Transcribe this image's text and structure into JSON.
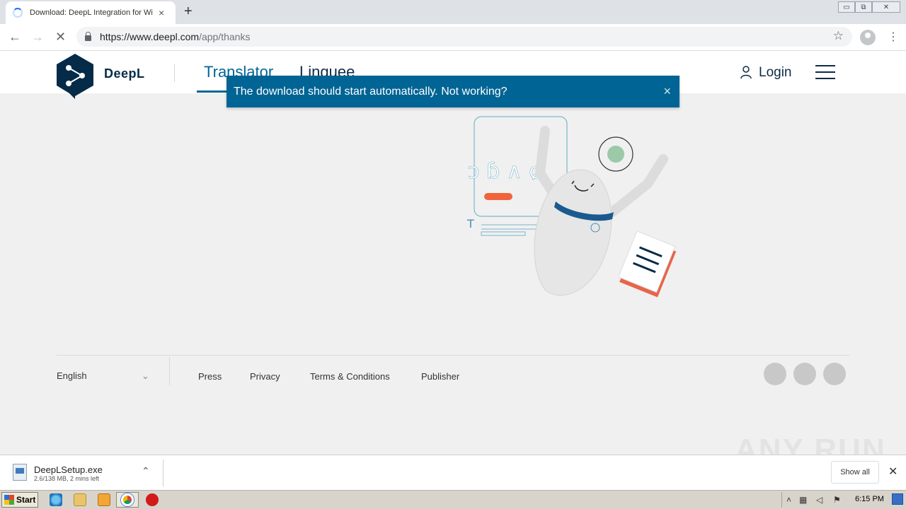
{
  "browser": {
    "tab_title": "Download: DeepL Integration for Wi",
    "tab_close": "×",
    "new_tab": "+",
    "url_host": "https://www.deepl.com",
    "url_path": "/app/thanks",
    "window_controls": [
      "▭",
      "⧉",
      "✕"
    ],
    "nav": {
      "back": "←",
      "forward": "→",
      "reload": "✕",
      "bookmark": "☆",
      "menu": "⋮"
    }
  },
  "site": {
    "brand": "DeepL",
    "nav": [
      {
        "label": "Translator",
        "active": true
      },
      {
        "label": "Linguee",
        "active": false
      }
    ],
    "login": "Login"
  },
  "toast": {
    "message": "The download should start automatically. Not working?",
    "close": "×"
  },
  "illustration": {
    "glyphs": "ɔ ɓ ∧ ɕ",
    "letter": "T"
  },
  "footer": {
    "language": "English",
    "language_chevron": "⌄",
    "links": [
      "Press",
      "Privacy",
      "Terms & Conditions",
      "Publisher"
    ],
    "social_icons": [
      "facebook-icon",
      "twitter-icon",
      "linkedin-icon"
    ]
  },
  "download_bar": {
    "file_name": "DeepLSetup.exe",
    "status": "2.6/138 MB, 2 mins left",
    "chevron": "⌃",
    "show_all": "Show all",
    "close": "✕",
    "watermark": "ANY RUN"
  },
  "taskbar": {
    "start": "Start",
    "clock": "6:15 PM"
  },
  "colors": {
    "deepl_blue": "#006494",
    "deepl_navy": "#042b48",
    "accent_orange": "#f0643c"
  }
}
